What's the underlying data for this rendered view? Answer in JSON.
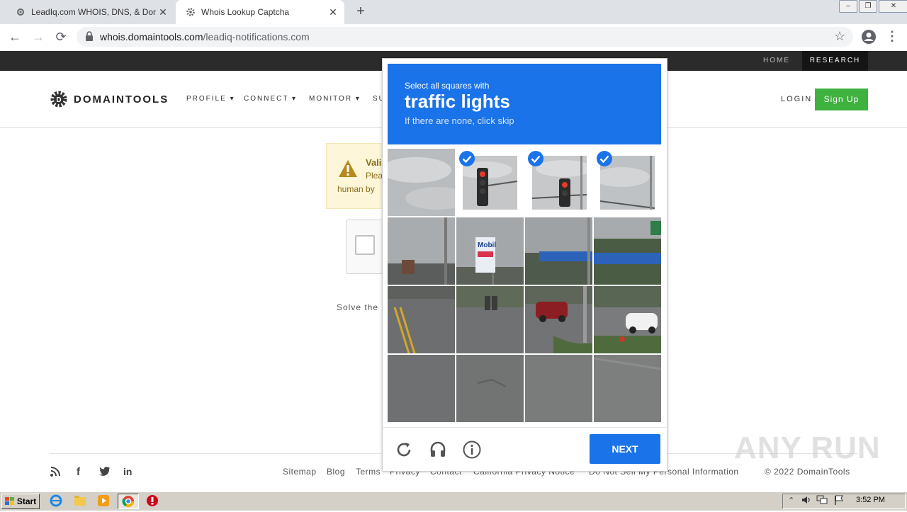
{
  "browser": {
    "tabs": [
      {
        "title": "LeadIq.com WHOIS, DNS, & Domain",
        "active": false
      },
      {
        "title": "Whois Lookup Captcha",
        "active": true
      }
    ],
    "url_host": "whois.domaintools.com",
    "url_path": "/leadiq-notifications.com"
  },
  "site": {
    "topbar": {
      "home": "HOME",
      "research": "RESEARCH"
    },
    "brand": "DOMAINTOOLS",
    "menu": [
      "PROFILE",
      "CONNECT",
      "MONITOR",
      "SU"
    ],
    "login": "LOGIN",
    "signup": "Sign Up",
    "warning": {
      "title": "Vali",
      "line1": "Plea",
      "line2": "human by"
    },
    "solve_text": "Solve the",
    "footer": {
      "links": [
        "Sitemap",
        "Blog",
        "Terms",
        "Privacy",
        "Contact",
        "California Privacy Notice",
        "Do Not Sell My Personal Information"
      ],
      "copyright": "© 2022 DomainTools"
    }
  },
  "captcha": {
    "instruction": "Select all squares with",
    "object": "traffic lights",
    "skip_hint": "If there are none, click skip",
    "next_label": "NEXT",
    "selected_tiles": [
      1,
      2,
      3
    ]
  },
  "watermark": "ANY RUN",
  "taskbar": {
    "start": "Start",
    "clock": "3:52 PM"
  },
  "colors": {
    "captcha_blue": "#1a73e8",
    "signup_green": "#3fb13f",
    "topbar_dark": "#2b2b2b"
  }
}
